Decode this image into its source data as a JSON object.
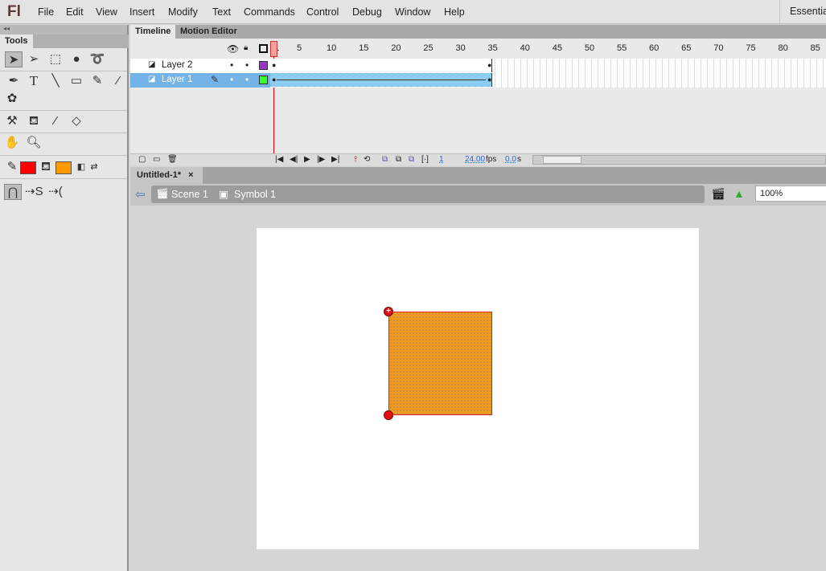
{
  "app": {
    "logo": "Fl",
    "workspace": "Essentials"
  },
  "menu": [
    "File",
    "Edit",
    "View",
    "Insert",
    "Modify",
    "Text",
    "Commands",
    "Control",
    "Debug",
    "Window",
    "Help"
  ],
  "tools": {
    "panel_title": "Tools",
    "stroke_color": "#ff0000",
    "fill_color": "#ff9900"
  },
  "timeline": {
    "tabs": [
      "Timeline",
      "Motion Editor"
    ],
    "ruler": [
      "1",
      "5",
      "10",
      "15",
      "20",
      "25",
      "30",
      "35",
      "40",
      "45",
      "50",
      "55",
      "60",
      "65",
      "70",
      "75",
      "80",
      "85"
    ],
    "layers": [
      {
        "name": "Layer 2",
        "color": "#9933cc",
        "selected": false
      },
      {
        "name": "Layer 1",
        "color": "#33ff33",
        "selected": true
      }
    ],
    "current_frame": "1",
    "fps": "24.00",
    "fps_unit": "fps",
    "time": "0.0",
    "time_unit": "s",
    "last_frame": 35
  },
  "document": {
    "tab": "Untitled-1*",
    "close": "×",
    "breadcrumbs": [
      "Scene 1",
      "Symbol 1"
    ],
    "zoom": "100%"
  },
  "stage": {
    "shape_fill": "#f29b18",
    "shape_stroke": "#e02020"
  }
}
